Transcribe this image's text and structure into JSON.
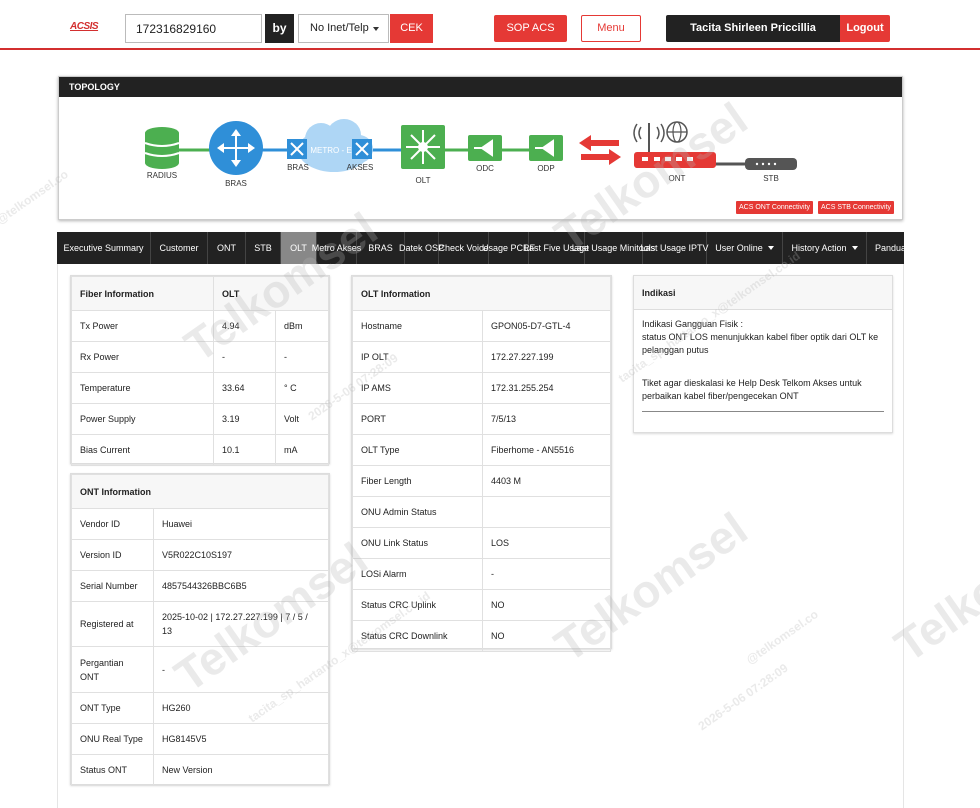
{
  "header": {
    "logo": "ACSIS",
    "search_value": "172316829160",
    "by_label": "by",
    "search_type": "No Inet/Telp",
    "cek_label": "CEK",
    "sop_label": "SOP ACS",
    "menu_label": "Menu",
    "user_name": "Tacita Shirleen Priccillia Hartanto",
    "logout_label": "Logout"
  },
  "topology": {
    "title": "TOPOLOGY",
    "nodes": {
      "radius": "RADIUS",
      "bras": "BRAS",
      "bras2": "BRAS",
      "metro": "METRO - E",
      "akses": "AKSES",
      "olt": "OLT",
      "odc": "ODC",
      "odp": "ODP",
      "ont": "ONT",
      "stb": "STB"
    },
    "acs_ont": "ACS ONT Connectivity",
    "acs_stb": "ACS STB Connectivity",
    "colors": {
      "green": "#4caf50",
      "blue": "#2f8fd8",
      "red": "#e53935",
      "gray": "#555555"
    }
  },
  "tabs": [
    {
      "label": "Executive Summary"
    },
    {
      "label": "Customer"
    },
    {
      "label": "ONT"
    },
    {
      "label": "STB"
    },
    {
      "label": "OLT",
      "active": true
    },
    {
      "label": "Metro Akses"
    },
    {
      "label": "BRAS"
    },
    {
      "label": "Datek OSP"
    },
    {
      "label": "Check Voice"
    },
    {
      "label": "Usage PCRF"
    },
    {
      "label": "Last Five Usage"
    },
    {
      "label": "Last Usage Minitools"
    },
    {
      "label": "Last Usage IPTV"
    },
    {
      "label": "User Online"
    },
    {
      "label": "History Action"
    },
    {
      "label": "Panduan Solusi"
    }
  ],
  "fiber": {
    "header": [
      "Fiber Information",
      "OLT"
    ],
    "rows": [
      [
        "Tx Power",
        "4.94",
        "dBm"
      ],
      [
        "Rx Power",
        "-",
        "-"
      ],
      [
        "Temperature",
        "33.64",
        "° C"
      ],
      [
        "Power Supply",
        "3.19",
        "Volt"
      ],
      [
        "Bias Current",
        "10.1",
        "mA"
      ]
    ]
  },
  "ont": {
    "header": "ONT Information",
    "rows": [
      [
        "Vendor ID",
        "Huawei"
      ],
      [
        "Version ID",
        "V5R022C10S197"
      ],
      [
        "Serial Number",
        "4857544326BBC6B5"
      ],
      [
        "Registered at",
        "2025-10-02 | 172.27.227.199 | 7 / 5 / 13"
      ],
      [
        "Pergantian ONT",
        "-"
      ],
      [
        "ONT Type",
        "HG260"
      ],
      [
        "ONU Real Type",
        "HG8145V5"
      ],
      [
        "Status ONT",
        "New Version"
      ]
    ]
  },
  "olt": {
    "header": "OLT Information",
    "rows": [
      [
        "Hostname",
        "GPON05-D7-GTL-4"
      ],
      [
        "IP OLT",
        "172.27.227.199"
      ],
      [
        "IP AMS",
        "172.31.255.254"
      ],
      [
        "PORT",
        "7/5/13"
      ],
      [
        "OLT Type",
        "Fiberhome - AN5516"
      ],
      [
        "Fiber Length",
        "4403 M"
      ],
      [
        "ONU Admin Status",
        ""
      ],
      [
        "ONU Link Status",
        "LOS"
      ],
      [
        "LOSi Alarm",
        "-"
      ],
      [
        "Status CRC Uplink",
        "NO"
      ],
      [
        "Status CRC Downlink",
        "NO"
      ]
    ]
  },
  "indikasi": {
    "title": "Indikasi",
    "line1": "Indikasi Gangguan Fisik :",
    "line2": "status ONT LOS menunjukkan kabel fiber optik dari OLT ke pelanggan putus",
    "line3": "Tiket agar dieskalasi ke Help Desk Telkom Akses untuk perbaikan kabel fiber/pengecekan ONT"
  },
  "watermark": {
    "brand": "Telkomsel",
    "email": "tacita_sp_hartanto_x@telkomsel.co.id",
    "date": "2026-5-06 07:28:09",
    "email_short": "@telkomsel.co"
  }
}
